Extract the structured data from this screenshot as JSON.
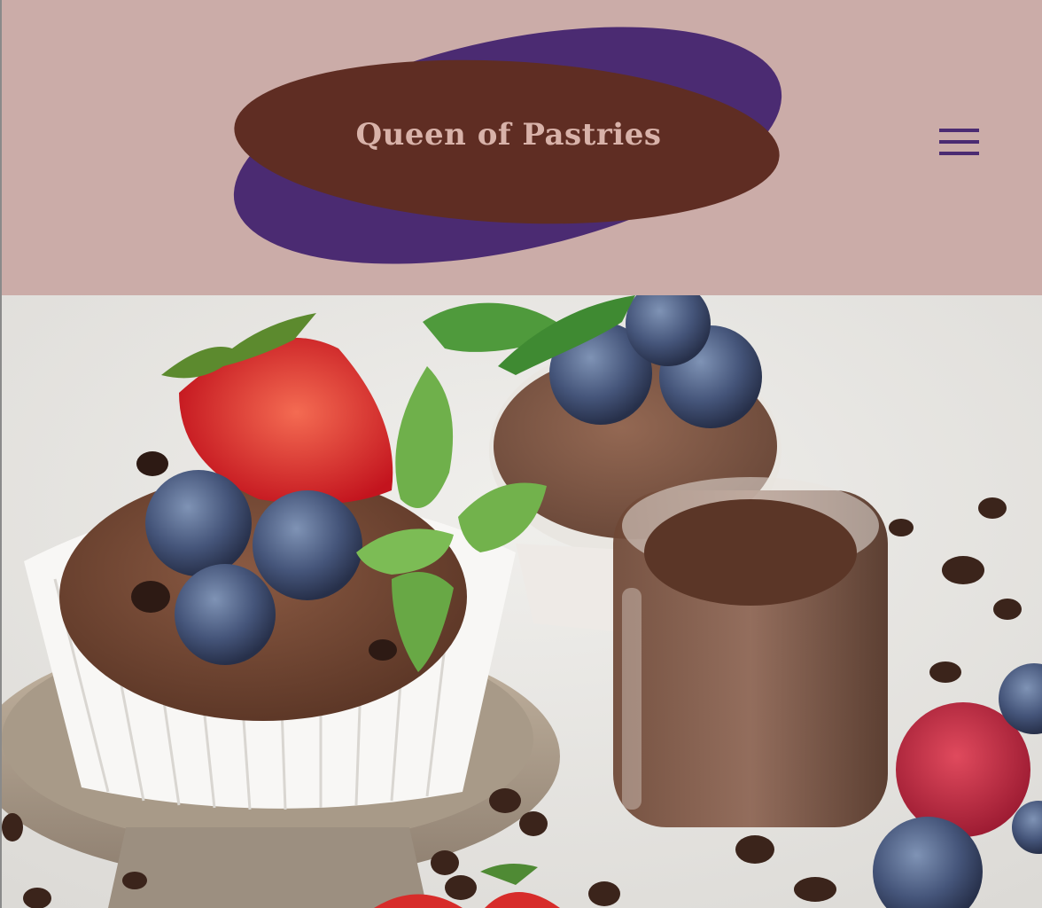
{
  "header": {
    "site_name": "Queen of Pastries",
    "menu_icon": "hamburger-menu-icon"
  },
  "colors": {
    "header_bg": "#cbaca8",
    "logo_brown": "#5f2d23",
    "logo_purple": "#4b2b72",
    "logo_text": "#d8b2a9",
    "menu_icon": "#4b2b72"
  },
  "hero": {
    "image_subject": "chocolate cupcakes with strawberry, blueberries and mint, jar of chocolate"
  }
}
